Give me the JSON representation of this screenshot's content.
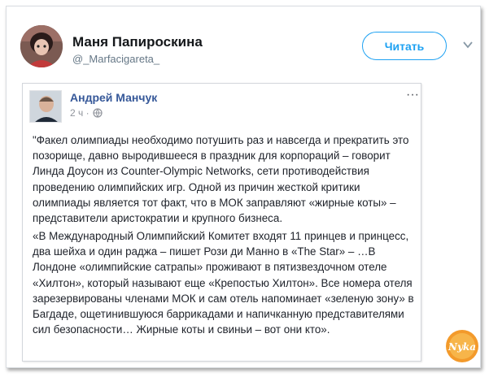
{
  "tweet": {
    "author_name": "Маня Папироскина",
    "author_handle": "@_Marfacigareta_",
    "follow_label": "Читать"
  },
  "fb_post": {
    "author_name": "Андрей Манчук",
    "time": "2 ч ·",
    "more": "···",
    "paragraph1": "\"Факел олимпиады необходимо потушить раз и навсегда и прекратить это позорище, давно выродившееся в праздник для корпораций – говорит Линда Доусон из Counter-Olympic Networks, сети противодействия проведению олимпийских игр. Одной из причин жесткой критики олимпиады является тот факт, что в МОК заправляют «жирные коты» – представители аристократии и крупного бизнеса.",
    "paragraph2": "«В Международный Олимпийский Комитет входят 11 принцев и принцесс, два шейха и один раджа – пишет Рози ди Манно в «The Star» – …В Лондоне «олимпийские сатрапы» проживают в пятизвездочном отеле «Хилтон», который называют еще «Крепостью Хилтон». Все номера отеля зарезервированы членами МОК и сам отель напоминает «зеленую зону» в Багдаде, ощетинившуюся баррикадами и напичканную представителями сил безопасности… Жирные коты и свиньи – вот они кто»."
  },
  "watermark": {
    "text": "Nyka"
  },
  "colors": {
    "accent": "#1da1f2",
    "fb_link": "#365899",
    "handle": "#657786"
  }
}
